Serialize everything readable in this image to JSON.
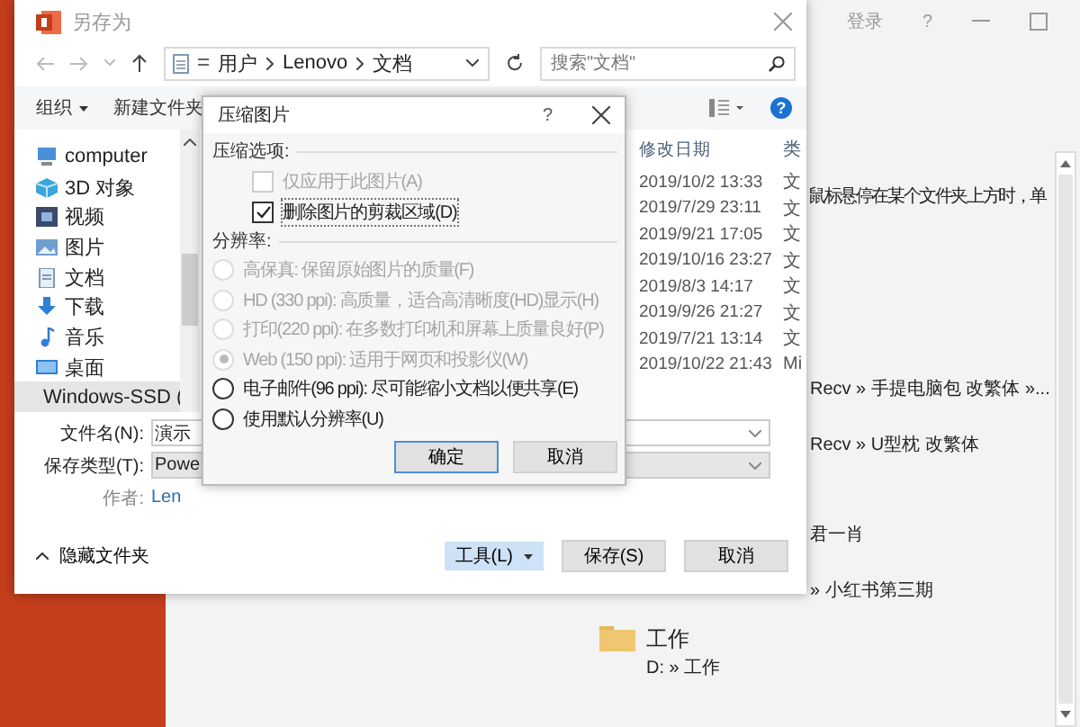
{
  "app": {
    "account": "登录",
    "help": "?"
  },
  "backstage": {
    "hint": "鼠标悬停在某个文件夹上方时，单",
    "items": [
      {
        "kind": "text",
        "path": "Recv » 手提电脑包 改繁体 »..."
      },
      {
        "kind": "text",
        "path": "Recv » U型枕 改繁体"
      },
      {
        "kind": "text",
        "path": "君一肖"
      },
      {
        "kind": "text",
        "path": "» 小红书第三期"
      },
      {
        "kind": "folder",
        "name": "工作",
        "path": "D: » 工作"
      }
    ]
  },
  "save_dialog": {
    "title": "另存为",
    "breadcrumb": [
      "用户",
      "Lenovo",
      "文档"
    ],
    "search": {
      "placeholder": "搜索\"文档\""
    },
    "toolbar": {
      "organize": "组织",
      "new_folder": "新建文件夹",
      "help": "?"
    },
    "nav": [
      {
        "label": "computer",
        "selected": false
      },
      {
        "label": "3D 对象",
        "selected": false
      },
      {
        "label": "视频",
        "selected": false
      },
      {
        "label": "图片",
        "selected": false
      },
      {
        "label": "文档",
        "selected": false
      },
      {
        "label": "下载",
        "selected": false
      },
      {
        "label": "音乐",
        "selected": false
      },
      {
        "label": "桌面",
        "selected": false
      },
      {
        "label": "Windows-SSD (",
        "selected": true
      }
    ],
    "columns": [
      "修改日期",
      "类"
    ],
    "rows": [
      {
        "date": "2019/10/2 13:33",
        "type": "文"
      },
      {
        "date": "2019/7/29 23:11",
        "type": "文"
      },
      {
        "date": "2019/9/21 17:05",
        "type": "文"
      },
      {
        "date": "2019/10/16 23:27",
        "type": "文"
      },
      {
        "date": "2019/8/3 14:17",
        "type": "文"
      },
      {
        "date": "2019/9/26 21:27",
        "type": "文"
      },
      {
        "date": "2019/7/21 13:14",
        "type": "文"
      },
      {
        "date": "2019/10/22 21:43",
        "type": "Mi"
      }
    ],
    "file_name": {
      "label": "文件名(N):",
      "value": "演示"
    },
    "file_type": {
      "label": "保存类型(T):",
      "value": "Powe"
    },
    "author": {
      "label": "作者:",
      "value": "Len"
    },
    "hide_folders": "隐藏文件夹",
    "tools": "工具(L)",
    "save": "保存(S)",
    "cancel": "取消"
  },
  "compress_dialog": {
    "title": "压缩图片",
    "help": "?",
    "options_label": "压缩选项:",
    "checks": [
      {
        "label": "仅应用于此图片(A)",
        "checked": false,
        "disabled": true
      },
      {
        "label": "删除图片的剪裁区域(D)",
        "checked": true,
        "disabled": false
      }
    ],
    "resolution_label": "分辨率:",
    "radios": [
      {
        "label": "高保真: 保留原始图片的质量(F)",
        "selected": false,
        "disabled": true
      },
      {
        "label": "HD (330 ppi): 高质量，适合高清晰度(HD)显示(H)",
        "selected": false,
        "disabled": true
      },
      {
        "label": "打印(220 ppi): 在多数打印机和屏幕上质量良好(P)",
        "selected": false,
        "disabled": true
      },
      {
        "label": "Web (150 ppi): 适用于网页和投影仪(W)",
        "selected": true,
        "disabled": true
      },
      {
        "label": "电子邮件(96 ppi): 尽可能缩小文档以便共享(E)",
        "selected": false,
        "disabled": false
      },
      {
        "label": "使用默认分辨率(U)",
        "selected": false,
        "disabled": false
      }
    ],
    "ok": "确定",
    "cancel": "取消"
  }
}
